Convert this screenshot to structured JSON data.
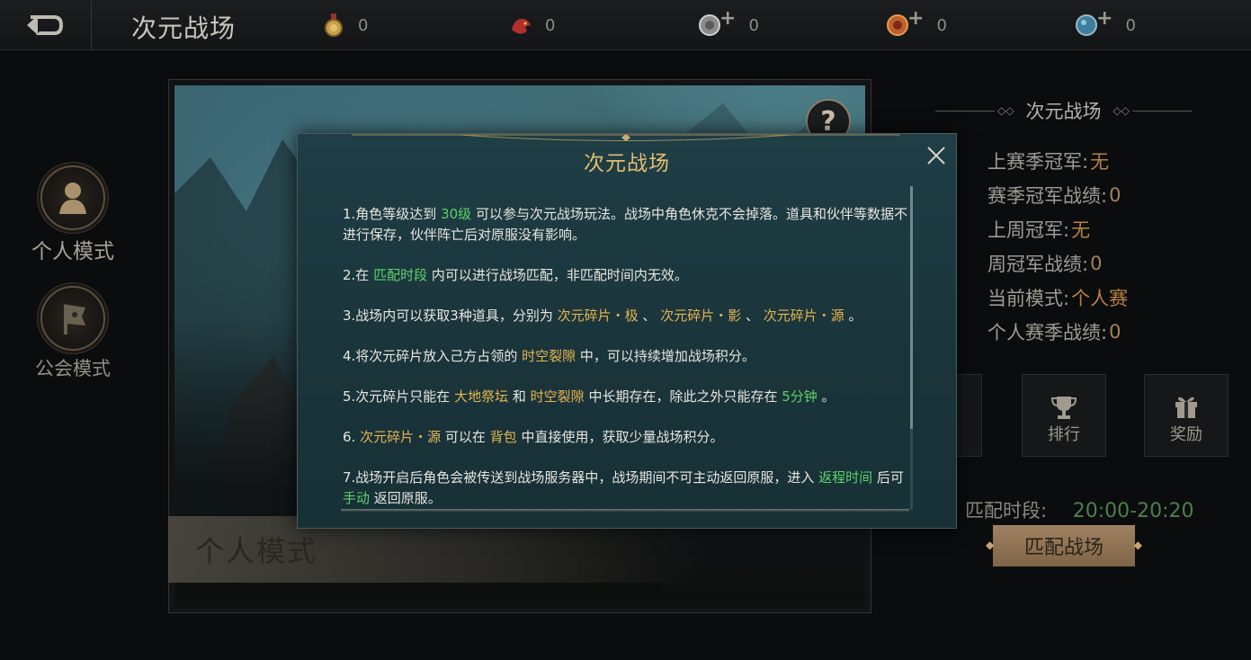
{
  "header": {
    "title": "次元战场",
    "currencies": [
      {
        "icon": "gold-medal-icon",
        "value": "0",
        "color": "#c9a14a",
        "has_plus": false
      },
      {
        "icon": "red-dragon-icon",
        "value": "0",
        "color": "#b0302c",
        "has_plus": false
      },
      {
        "icon": "silver-coin-icon",
        "value": "0",
        "color": "#9a9a9a",
        "has_plus": true
      },
      {
        "icon": "bronze-coin-icon",
        "value": "0",
        "color": "#c0602c",
        "has_plus": true
      },
      {
        "icon": "blue-orb-icon",
        "value": "0",
        "color": "#3e7fa0",
        "has_plus": true
      }
    ],
    "plus_symbol": "+"
  },
  "sidebar": {
    "modes": [
      {
        "label": "个人模式",
        "icon": "person-icon"
      },
      {
        "label": "公会模式",
        "icon": "guild-flag-icon"
      }
    ]
  },
  "main": {
    "help_symbol": "?",
    "banner_label": "个人模式"
  },
  "info": {
    "title": "次元战场",
    "rows": [
      {
        "label": "上赛季冠军:",
        "value": "无"
      },
      {
        "label": "赛季冠军战绩:",
        "value": "0"
      },
      {
        "label": "上周冠军:",
        "value": "无"
      },
      {
        "label": "周冠军战绩:",
        "value": "0"
      },
      {
        "label": "当前模式:",
        "value": "个人赛"
      },
      {
        "label": "个人赛季战绩:",
        "value": "0"
      }
    ],
    "buttons": [
      {
        "label": "排行",
        "icon": "trophy-icon"
      },
      {
        "label": "奖励",
        "icon": "gift-icon"
      }
    ],
    "match_label": "匹配时段:",
    "match_time": "20:00-20:20",
    "match_button": "匹配战场"
  },
  "modal": {
    "title": "次元战场",
    "paragraphs": [
      [
        {
          "t": "1.角色等级达到 "
        },
        {
          "t": "30级",
          "c": "green"
        },
        {
          "t": " 可以参与次元战场玩法。战场中角色休克不会掉落。道具和伙伴等数据不进行保存，伙伴阵亡后对原服没有影响。"
        }
      ],
      [
        {
          "t": "2.在 "
        },
        {
          "t": "匹配时段",
          "c": "green"
        },
        {
          "t": " 内可以进行战场匹配，非匹配时间内无效。"
        }
      ],
      [
        {
          "t": "3.战场内可以获取3种道具，分别为 "
        },
        {
          "t": "次元碎片・极",
          "c": "yellow"
        },
        {
          "t": " 、 "
        },
        {
          "t": "次元碎片・影",
          "c": "yellow"
        },
        {
          "t": " 、 "
        },
        {
          "t": "次元碎片・源",
          "c": "yellow"
        },
        {
          "t": " 。"
        }
      ],
      [
        {
          "t": "4.将次元碎片放入己方占领的 "
        },
        {
          "t": "时空裂隙",
          "c": "yellow"
        },
        {
          "t": " 中，可以持续增加战场积分。"
        }
      ],
      [
        {
          "t": "5.次元碎片只能在 "
        },
        {
          "t": "大地祭坛",
          "c": "yellow"
        },
        {
          "t": " 和 "
        },
        {
          "t": "时空裂隙",
          "c": "yellow"
        },
        {
          "t": " 中长期存在，除此之外只能存在 "
        },
        {
          "t": "5分钟",
          "c": "green"
        },
        {
          "t": " 。"
        }
      ],
      [
        {
          "t": "6. "
        },
        {
          "t": "次元碎片・源",
          "c": "yellow"
        },
        {
          "t": " 可以在 "
        },
        {
          "t": "背包",
          "c": "yellow"
        },
        {
          "t": " 中直接使用，获取少量战场积分。"
        }
      ],
      [
        {
          "t": "7.战场开启后角色会被传送到战场服务器中，战场期间不可主动返回原服，进入 "
        },
        {
          "t": "返程时间",
          "c": "green"
        },
        {
          "t": " 后可 "
        },
        {
          "t": "手动",
          "c": "green"
        },
        {
          "t": " 返回原服。"
        }
      ]
    ]
  }
}
